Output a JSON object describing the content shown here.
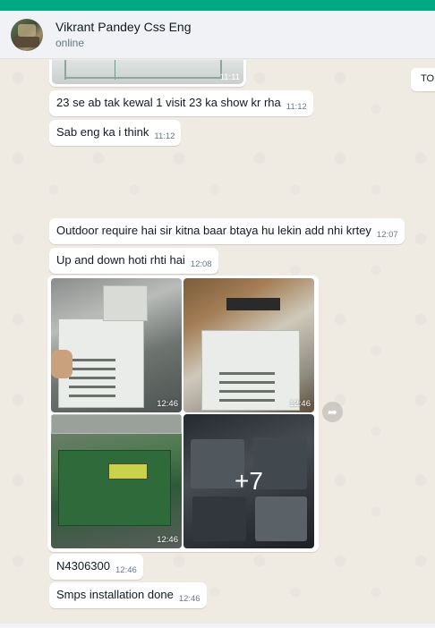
{
  "header": {
    "contact_name": "Vikrant Pandey Css Eng",
    "status": "online"
  },
  "side_tab": {
    "label": "TOI"
  },
  "messages": [
    {
      "type": "image",
      "time": "11:11"
    },
    {
      "type": "text",
      "text": "23 se ab tak kewal 1 visit 23 ka show kr rha",
      "time": "11:12"
    },
    {
      "type": "text",
      "text": "Sab eng ka i think",
      "time": "11:12"
    },
    {
      "type": "text",
      "text": "Outdoor require hai sir kitna baar btaya hu lekin add nhi krtey",
      "time": "12:07"
    },
    {
      "type": "text",
      "text": "Up and down hoti rhti hai",
      "time": "12:08"
    },
    {
      "type": "album",
      "times": [
        "12:46",
        "12:46",
        "12:46"
      ],
      "more_count": "+7"
    },
    {
      "type": "text",
      "text": "N4306300",
      "time": "12:46"
    },
    {
      "type": "text",
      "text": "Smps installation done",
      "time": "12:46"
    }
  ],
  "icons": {
    "forward": "forward-icon"
  },
  "colors": {
    "accent": "#00a884",
    "chat_bg": "#efeae2",
    "bubble": "#ffffff"
  }
}
